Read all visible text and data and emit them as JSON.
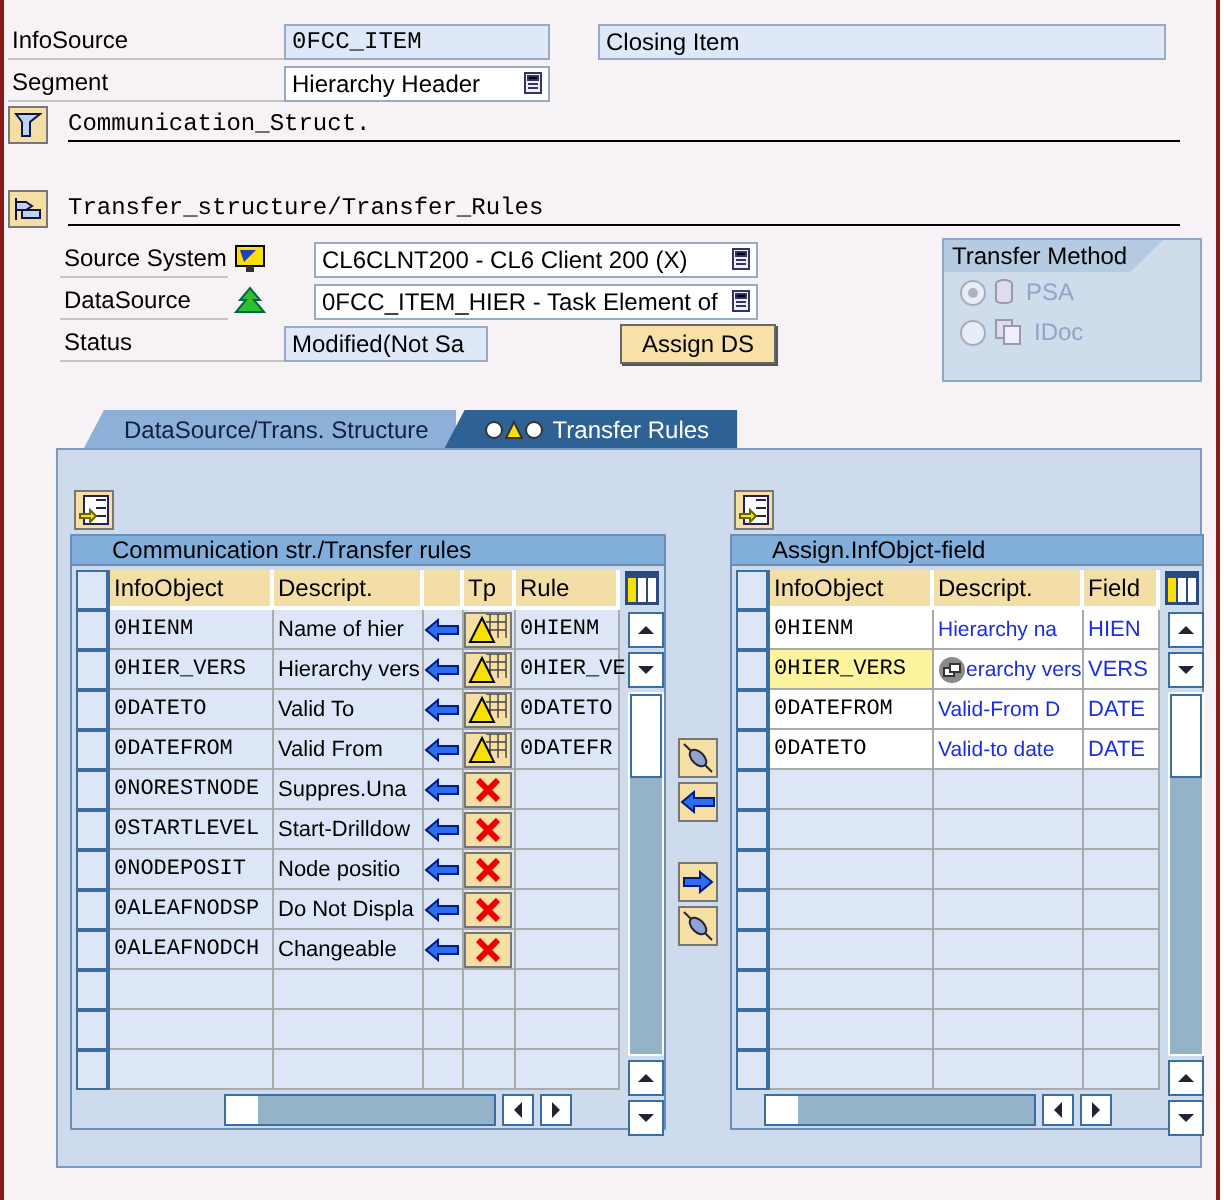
{
  "infosource": {
    "label": "InfoSource",
    "value": "0FCC_ITEM",
    "text": "Closing Item"
  },
  "segment": {
    "label": "Segment",
    "value": "Hierarchy Header"
  },
  "sections": [
    {
      "title": "Communication_Struct.",
      "expanded": false
    },
    {
      "title": "Transfer_structure/Transfer_Rules",
      "expanded": true
    }
  ],
  "source_system": {
    "label": "Source System",
    "value": "CL6CLNT200 - CL6 Client 200 (X)"
  },
  "datasource": {
    "label": "DataSource",
    "value": "0FCC_ITEM_HIER - Task Element of"
  },
  "status": {
    "label": "Status",
    "value": "Modified(Not Sa"
  },
  "assign_button": "Assign DS",
  "transfer_method": {
    "title": "Transfer Method",
    "options": [
      {
        "label": "PSA",
        "selected": true,
        "disabled": true
      },
      {
        "label": "IDoc",
        "selected": false,
        "disabled": true
      }
    ]
  },
  "tabs": [
    {
      "label": "DataSource/Trans. Structure",
      "selected": false
    },
    {
      "label": "Transfer Rules",
      "selected": true
    }
  ],
  "left_table": {
    "title": "Communication str./Transfer rules",
    "columns": [
      "InfoObject",
      "Descript.",
      "",
      "Tp",
      "Rule"
    ],
    "rows": [
      {
        "infoobject": "0HIENM",
        "descript": "Name of hier",
        "kind": "formula",
        "rule": "0HIENM"
      },
      {
        "infoobject": "0HIER_VERS",
        "descript": "Hierarchy vers",
        "kind": "formula",
        "rule": "0HIER_VE"
      },
      {
        "infoobject": "0DATETO",
        "descript": "Valid To",
        "kind": "formula",
        "rule": "0DATETO"
      },
      {
        "infoobject": "0DATEFROM",
        "descript": "Valid From",
        "kind": "formula",
        "rule": "0DATEFR"
      },
      {
        "infoobject": "0NORESTNODE",
        "descript": "Suppres.Una",
        "kind": "none"
      },
      {
        "infoobject": "0STARTLEVEL",
        "descript": "Start-Drilldow",
        "kind": "none"
      },
      {
        "infoobject": "0NODEPOSIT",
        "descript": "Node positio",
        "kind": "none"
      },
      {
        "infoobject": "0ALEAFNODSP",
        "descript": "Do Not Displa",
        "kind": "none"
      },
      {
        "infoobject": "0ALEAFNODCH",
        "descript": "Changeable",
        "kind": "none"
      }
    ]
  },
  "right_table": {
    "title": "Assign.InfObjct-field",
    "columns": [
      "InfoObject",
      "Descript.",
      "Field"
    ],
    "rows": [
      {
        "infoobject": "0HIENM",
        "descript": "Hierarchy na",
        "field": "HIEN",
        "selected": false
      },
      {
        "infoobject": "0HIER_VERS",
        "descript": "erarchy vers",
        "field": "VERS",
        "selected": true
      },
      {
        "infoobject": "0DATEFROM",
        "descript": "Valid-From D",
        "field": "DATE",
        "selected": false
      },
      {
        "infoobject": "0DATETO",
        "descript": "Valid-to date",
        "field": "DATE",
        "selected": false
      }
    ]
  }
}
